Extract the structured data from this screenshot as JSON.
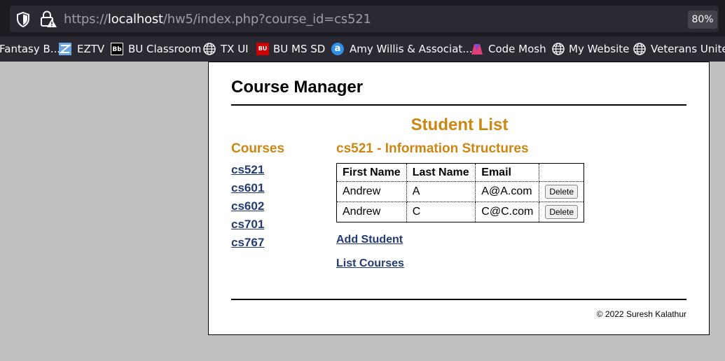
{
  "browser": {
    "url_prefix": "https://",
    "url_host": "localhost",
    "url_path": "/hw5/index.php?course_id=cs521",
    "zoom": "80%"
  },
  "bookmarks": [
    {
      "label": "Fantasy B...",
      "icon": "none"
    },
    {
      "label": "EZTV",
      "icon": "eztv-logo-icon"
    },
    {
      "label": "BU Classroom",
      "icon": "blackboard-icon",
      "glyph": "Bb"
    },
    {
      "label": "TX UI",
      "icon": "globe-icon"
    },
    {
      "label": "BU MS SD",
      "icon": "bu-logo-icon",
      "glyph": "BU"
    },
    {
      "label": "Amy Willis & Associat...",
      "icon": "letter-a-icon",
      "glyph": "a"
    },
    {
      "label": "Code Mosh",
      "icon": "code-mosh-icon"
    },
    {
      "label": "My Website",
      "icon": "globe-icon"
    },
    {
      "label": "Veterans United",
      "icon": "globe-icon"
    }
  ],
  "colors": {
    "accent": "#cc8612",
    "link": "#233a78",
    "page_bg": "#c0c0c0"
  },
  "page": {
    "title": "Course Manager",
    "section_title": "Student List",
    "courses_heading": "Courses",
    "courses": [
      "cs521",
      "cs601",
      "cs602",
      "cs701",
      "cs767"
    ],
    "course_heading": "cs521 - Information Structures",
    "table": {
      "headers": [
        "First Name",
        "Last Name",
        "Email",
        ""
      ],
      "rows": [
        {
          "first": "Andrew",
          "last": "A",
          "email": "A@A.com",
          "action": "Delete"
        },
        {
          "first": "Andrew",
          "last": "C",
          "email": "C@C.com",
          "action": "Delete"
        }
      ]
    },
    "add_student": "Add Student",
    "list_courses": "List Courses",
    "footer": "© 2022 Suresh Kalathur"
  }
}
